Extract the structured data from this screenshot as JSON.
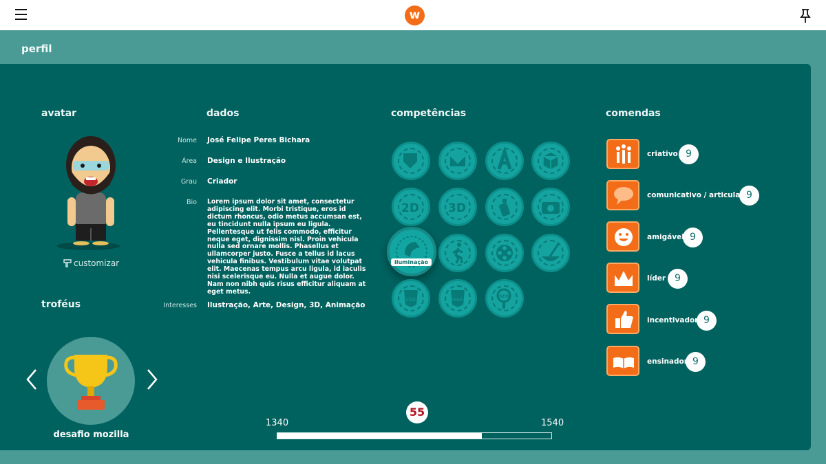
{
  "header": {
    "logo_letter": "w",
    "menu_icon": "hamburger-icon",
    "pin_icon": "pin-icon"
  },
  "page": {
    "title": "perfil"
  },
  "sections": {
    "avatar": "avatar",
    "dados": "dados",
    "competencias": "competências",
    "comendas": "comendas",
    "trofeus": "troféus"
  },
  "avatar": {
    "customize_label": "customizar"
  },
  "profile": {
    "fields": [
      {
        "label": "Nome",
        "value": "José Felipe Peres Bichara"
      },
      {
        "label": "Área",
        "value": "Design e Ilustração"
      },
      {
        "label": "Grau",
        "value": "Criador"
      },
      {
        "label": "Bio",
        "value": "Lorem ipsum dolor sit amet, consectetur adipiscing elit. Morbi tristique, eros id dictum rhoncus, odio metus accumsan est, eu tincidunt nulla ipsum eu ligula. Pellentesque ut felis commodo, efficitur neque eget, dignissim nisl. Proin vehicula nulla sed ornare mollis. Phasellus et ullamcorper justo. Fusce a tellus id lacus vehicula finibus. Vestibulum vitae volutpat elit. Maecenas tempus arcu ligula, id iaculis nisi scelerisque eu. Nulla et augue dolor. Nam non nibh quis risus efficitur aliquam at eget metus."
      },
      {
        "label": "Interesses",
        "value": "Ilustração, Arte, Design, 3D, Animação"
      }
    ]
  },
  "skills": {
    "tooltip": "iluminação",
    "items": [
      "shapes-icon",
      "envelope-icon",
      "type-a-icon",
      "cube-icon",
      "2d-icon",
      "3d-film-icon",
      "spray-can-icon",
      "camera-icon",
      "lamp-icon",
      "walking-icon",
      "film-reel-icon",
      "paint-bucket-icon",
      "css-icon",
      "html-icon",
      "seo-icon"
    ]
  },
  "badges": [
    {
      "name": "criativo",
      "count": "9",
      "icon": "creative-icon"
    },
    {
      "name": "comunicativo / articulado",
      "count": "9",
      "icon": "speech-bubble-icon"
    },
    {
      "name": "amigável",
      "count": "9",
      "icon": "smiley-icon"
    },
    {
      "name": "líder",
      "count": "9",
      "icon": "crown-icon"
    },
    {
      "name": "incentivador",
      "count": "9",
      "icon": "thumbs-up-icon"
    },
    {
      "name": "ensinador",
      "count": "9",
      "icon": "book-icon"
    }
  ],
  "trophy": {
    "name": "desafio mozilla",
    "icon": "trophy-icon"
  },
  "progress": {
    "min": "1340",
    "max": "1540",
    "level": "55",
    "fraction": 0.745
  },
  "colors": {
    "header_bg": "#ffffff",
    "page_bg": "#4a9a96",
    "panel_bg": "#00625f",
    "accent_orange": "#f36c17",
    "skill_teal": "#15a3a0",
    "level_red": "#b3121f"
  }
}
